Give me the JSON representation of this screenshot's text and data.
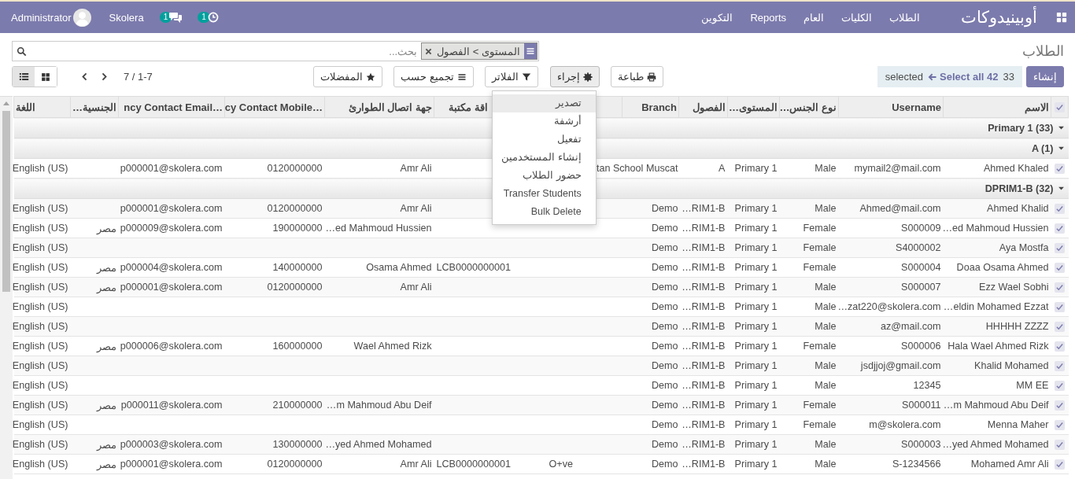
{
  "navbar": {
    "brand": "أوبينيدوكات",
    "menu": [
      {
        "label": "الطلاب"
      },
      {
        "label": "الكليات"
      },
      {
        "label": "العام"
      },
      {
        "label": "Reports"
      },
      {
        "label": "التكوين"
      }
    ],
    "systray": [
      {
        "kind": "user",
        "label": "Administrator"
      },
      {
        "kind": "company",
        "label": "Skolera"
      },
      {
        "kind": "messages",
        "badge": "1"
      },
      {
        "kind": "activity",
        "badge": "1"
      }
    ]
  },
  "control_panel": {
    "breadcrumb": "الطلاب",
    "search": {
      "facets": [
        {
          "label": "المستوى > الفصول"
        }
      ],
      "placeholder": "بحث..."
    },
    "create_button": "إنشاء",
    "selection": {
      "count": "33",
      "select_all": "Select all 42",
      "text": "selected"
    },
    "print_button": "طباعة",
    "action_button": {
      "label": "إجراء",
      "expanded": true,
      "items": [
        {
          "label": "تصدير",
          "selected": true
        },
        {
          "label": "أرشفة",
          "selected": false
        },
        {
          "label": "تفعيل",
          "selected": false
        },
        {
          "label": "إنشاء المستخدمين",
          "selected": false
        },
        {
          "label": "حضور الطلاب",
          "selected": false
        },
        {
          "label": "Transfer Students",
          "selected": false
        },
        {
          "label": "Bulk Delete",
          "selected": false
        }
      ]
    },
    "filters_button": "الفلاتر",
    "group_by_button": "تجميع حسب",
    "favorites_button": "المفضلات",
    "pager": "7 / 1-7",
    "views": [
      {
        "kind": "kanban",
        "selected": false
      },
      {
        "kind": "list",
        "selected": true
      }
    ]
  },
  "table": {
    "header_checkbox": {
      "checked": true
    },
    "columns": [
      {
        "label": "الاسم"
      },
      {
        "label": "Username"
      },
      {
        "label": "نوع الجنس…"
      },
      {
        "label": "المستوى…"
      },
      {
        "label": "الفصول"
      },
      {
        "label": "Branch"
      },
      {},
      {
        "label": "اقة مكتبة"
      },
      {
        "label": "جهة اتصال الطوارئ"
      },
      {
        "label": "…cy Contact Mobile"
      },
      {
        "label": "…ncy Contact Email"
      },
      {
        "label": "الجنسية…"
      },
      {
        "label": "اللغة"
      }
    ],
    "groups": [
      {
        "label": "Primary 1 (33)",
        "expanded": true,
        "children": [
          {
            "label": "A (1)",
            "expanded": true,
            "rows": [
              {
                "selected": true,
                "name": "Ahmed Khaled",
                "username": "mymail2@mail.com",
                "gender": "Male",
                "level": "Primary 1",
                "class": "A",
                "branch": "tan School Muscat",
                "emergency_contact": "Amr Ali",
                "emergency_mobile": "0120000000",
                "emergency_email": "p000001@skolera.com",
                "language": "English (US)"
              }
            ]
          },
          {
            "label": "DPRIM1-B (32)",
            "expanded": true,
            "rows": [
              {
                "selected": true,
                "name": "Ahmed Khalid",
                "username": "Ahmed@mail.com",
                "gender": "Male",
                "level": "Primary 1",
                "class": "…RIM1-B",
                "branch": "Demo",
                "emergency_contact": "Amr Ali",
                "emergency_mobile": "0120000000",
                "emergency_email": "p000001@skolera.com",
                "language": "English (US)"
              },
              {
                "selected": true,
                "name": "…ed Mahmoud Hussien",
                "username": "S000009",
                "gender": "Female",
                "level": "Primary 1",
                "class": "…RIM1-B",
                "branch": "Demo",
                "emergency_contact": "…ed Mahmoud Hussien",
                "emergency_mobile": "190000000",
                "emergency_email": "p000009@skolera.com",
                "nationality": "مصر",
                "language": "English (US)"
              },
              {
                "selected": true,
                "name": "Aya Mostfa",
                "username": "S4000002",
                "gender": "Female",
                "level": "Primary 1",
                "class": "…RIM1-B",
                "branch": "Demo",
                "language": "English (US)"
              },
              {
                "selected": true,
                "name": "Doaa Osama Ahmed",
                "username": "S000004",
                "gender": "Female",
                "level": "Primary 1",
                "class": "…RIM1-B",
                "branch": "Demo",
                "library_card": "LCB0000000001",
                "emergency_contact": "Osama Ahmed",
                "emergency_mobile": "140000000",
                "emergency_email": "p000004@skolera.com",
                "nationality": "مصر",
                "language": "English (US)"
              },
              {
                "selected": true,
                "name": "Ezz Wael Sobhi",
                "username": "S000007",
                "gender": "Male",
                "level": "Primary 1",
                "class": "…RIM1-B",
                "branch": "Demo",
                "emergency_contact": "Amr Ali",
                "emergency_mobile": "0120000000",
                "emergency_email": "p000001@skolera.com",
                "nationality": "مصر",
                "language": "English (US)"
              },
              {
                "selected": true,
                "name": "…eldin Mohamed Ezzat",
                "username": "…zat220@skolera.com",
                "gender": "Male",
                "level": "Primary 1",
                "class": "…RIM1-B",
                "branch": "Demo",
                "language": "English (US)"
              },
              {
                "selected": true,
                "name": "HHHHH ZZZZ",
                "username": "az@mail.com",
                "gender": "Male",
                "level": "Primary 1",
                "class": "…RIM1-B",
                "branch": "Demo",
                "language": "English (US)"
              },
              {
                "selected": true,
                "name": "Hala Wael Ahmed Rizk",
                "username": "S000006",
                "gender": "Female",
                "level": "Primary 1",
                "class": "…RIM1-B",
                "branch": "Demo",
                "emergency_contact": "Wael Ahmed Rizk",
                "emergency_mobile": "160000000",
                "emergency_email": "p000006@skolera.com",
                "nationality": "مصر",
                "language": "English (US)"
              },
              {
                "selected": true,
                "name": "Khalid Mohamed",
                "username": "jsdjjoj@gmail.com",
                "gender": "Male",
                "level": "Primary 1",
                "class": "…RIM1-B",
                "branch": "Demo",
                "language": "English (US)"
              },
              {
                "selected": true,
                "name": "MM EE",
                "username": "12345",
                "gender": "Male",
                "level": "Primary 1",
                "class": "…RIM1-B",
                "branch": "Demo",
                "language": "English (US)"
              },
              {
                "selected": true,
                "name": "…m Mahmoud Abu Deif",
                "username": "S000011",
                "gender": "Female",
                "level": "Primary 1",
                "class": "…RIM1-B",
                "branch": "Demo",
                "emergency_contact": "…m Mahmoud Abu Deif",
                "emergency_mobile": "210000000",
                "emergency_email": "p000011@skolera.com",
                "nationality": "مصر",
                "language": "English (US)"
              },
              {
                "selected": true,
                "name": "Menna Maher",
                "username": "m@skolera.com",
                "gender": "Female",
                "level": "Primary 1",
                "class": "…RIM1-B",
                "branch": "Demo",
                "language": "English (US)"
              },
              {
                "selected": true,
                "name": "…yed Ahmed Mohamed",
                "username": "S000003",
                "gender": "Male",
                "level": "Primary 1",
                "class": "…RIM1-B",
                "branch": "Demo",
                "emergency_contact": "…yed Ahmed Mohamed",
                "emergency_mobile": "130000000",
                "emergency_email": "p000003@skolera.com",
                "nationality": "مصر",
                "language": "English (US)"
              },
              {
                "selected": true,
                "name": "Mohamed Amr Ali",
                "username": "S-1234566",
                "gender": "Male",
                "level": "Primary 1",
                "class": "…RIM1-B",
                "branch": "Demo",
                "column_7": "O+ve",
                "library_card": "LCB0000000001",
                "emergency_contact": "Amr Ali",
                "emergency_mobile": "0120000000",
                "emergency_email": "p000001@skolera.com",
                "nationality": "مصر",
                "language": "English (US)"
              }
            ]
          }
        ]
      }
    ]
  }
}
